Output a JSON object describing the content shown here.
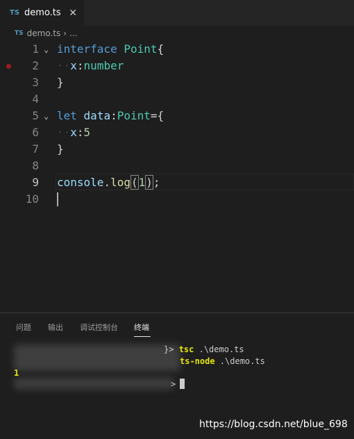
{
  "tab": {
    "icon": "TS",
    "label": "demo.ts",
    "close": "✕"
  },
  "breadcrumb": {
    "icon": "TS",
    "file": "demo.ts",
    "separator": "›",
    "more": "..."
  },
  "editor": {
    "lines": [
      {
        "num": "1"
      },
      {
        "num": "2"
      },
      {
        "num": "3"
      },
      {
        "num": "4"
      },
      {
        "num": "5"
      },
      {
        "num": "6"
      },
      {
        "num": "7"
      },
      {
        "num": "8"
      },
      {
        "num": "9"
      },
      {
        "num": "10"
      }
    ],
    "tokens": {
      "l1_kw": "interface",
      "l1_type": "Point",
      "l1_brace": "{",
      "l2_dots": "··",
      "l2_var": "x",
      "l2_colon": ":",
      "l2_type": "number",
      "l3_brace": "}",
      "l5_kw": "let",
      "l5_var": "data",
      "l5_colon": ":",
      "l5_type": "Point",
      "l5_eq": "=",
      "l5_brace": "{",
      "l6_dots": "··",
      "l6_var": "x",
      "l6_colon": ":",
      "l6_num": "5",
      "l7_brace": "}",
      "l9_obj": "console",
      "l9_dot": ".",
      "l9_fn": "log",
      "l9_open": "(",
      "l9_num": "1",
      "l9_close": ")",
      "l9_semi": ";"
    },
    "fold_icon": "⌄",
    "active_line": "9",
    "colors": {
      "keyword": "#569cd6",
      "type": "#4ec9b0",
      "variable": "#9cdcfe",
      "number": "#b5cea8",
      "function": "#dcdcaa"
    }
  },
  "panel": {
    "tabs": [
      "问题",
      "输出",
      "调试控制台",
      "终端"
    ],
    "active_tab": "终端"
  },
  "terminal": {
    "cmd1": "tsc",
    "arg1": " .\\demo.ts",
    "cmd2": "ts-node",
    "arg2": " .\\demo.ts",
    "output": "1",
    "prompt_suffix": ">",
    "prompt_fragment": "}>"
  },
  "watermark": "https://blog.csdn.net/blue_698"
}
